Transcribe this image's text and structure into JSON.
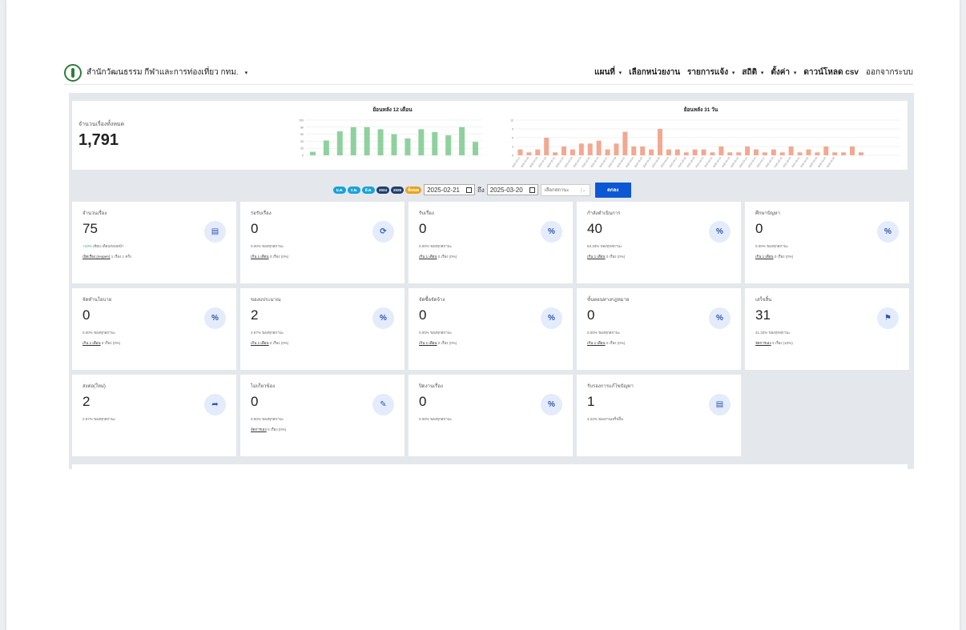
{
  "brand": {
    "name": "สำนักวัฒนธรรม กีฬาและการท่องเที่ยว กทม.",
    "caret": "▾"
  },
  "menu": [
    {
      "label": "แผนที่",
      "caret": "▾",
      "plain": false
    },
    {
      "label": "เลือกหน่วยงาน",
      "caret": "",
      "plain": false
    },
    {
      "label": "รายการแจ้ง",
      "caret": "▾",
      "plain": false
    },
    {
      "label": "สถิติ",
      "caret": "▾",
      "plain": false
    },
    {
      "label": "ตั้งค่า",
      "caret": "▾",
      "plain": false
    },
    {
      "label": "ดาวน์โหลด csv",
      "caret": "",
      "plain": false
    },
    {
      "label": "ออกจากระบบ",
      "caret": "",
      "plain": true
    }
  ],
  "summary": {
    "label": "จำนวนเรื่องทั้งหมด",
    "value": "1,791"
  },
  "chart_data": [
    {
      "type": "bar",
      "title": "ย้อนหลัง 12 เดือน",
      "ylim": [
        0,
        100
      ],
      "yticks": [
        "100",
        "80",
        "60",
        "40",
        "20",
        "0"
      ],
      "categories": [
        "1",
        "2",
        "3",
        "4",
        "5",
        "6",
        "7",
        "8",
        "9",
        "10",
        "11",
        "12"
      ],
      "values": [
        10,
        42,
        68,
        80,
        80,
        74,
        60,
        48,
        74,
        66,
        57,
        80,
        38
      ],
      "color": "#8fd19e"
    },
    {
      "type": "bar",
      "title": "ย้อนหลัง 31 วัน",
      "ylim": [
        0,
        12
      ],
      "yticks": [
        "12",
        "9",
        "6",
        "3",
        "0"
      ],
      "categories": [
        "2025-02-17",
        "2025-02-18",
        "2025-02-19",
        "2025-02-20",
        "2025-02-21",
        "2025-02-22",
        "2025-02-23",
        "2025-02-24",
        "2025-02-25",
        "2025-02-26",
        "2025-02-27",
        "2025-02-28",
        "2025-03-01",
        "2025-03-02",
        "2025-03-03",
        "2025-03-04",
        "2025-03-05",
        "2025-03-06",
        "2025-03-07",
        "2025-03-08",
        "2025-03-09",
        "2025-03-10",
        "2025-03-11",
        "2025-03-12",
        "2025-03-13",
        "2025-03-14",
        "2025-03-15",
        "2025-03-16",
        "2025-03-17",
        "2025-03-18",
        "2025-03-19",
        "2025-03-20",
        "2025-03-21",
        "2025-03-22",
        "2025-03-23",
        "2025-03-24",
        "2025-03-25"
      ],
      "values": [
        2,
        1,
        2,
        6,
        1,
        3,
        2,
        4,
        4,
        5,
        2,
        4,
        8,
        3,
        3,
        2,
        9,
        2,
        2,
        1,
        2,
        2,
        1,
        3,
        1,
        1,
        3,
        2,
        1,
        2,
        1,
        3,
        1,
        2,
        1,
        3,
        1,
        1,
        3,
        1,
        0,
        0,
        0,
        0
      ],
      "color": "#f2a891"
    }
  ],
  "filters": {
    "pills": [
      {
        "label": "ม.ค.",
        "color": "#17a2d8"
      },
      {
        "label": "ก.พ.",
        "color": "#17a2d8"
      },
      {
        "label": "มี.ค.",
        "color": "#17a2d8"
      },
      {
        "label": "2024",
        "color": "#1f3e6e"
      },
      {
        "label": "2025",
        "color": "#1f3e6e"
      },
      {
        "label": "ทั้งหมด",
        "color": "#e8a21a"
      }
    ],
    "date_from": "2025-02-21",
    "to_label": "ถึง",
    "date_to": "2025-03-20",
    "status_placeholder": "เลือกสถานะ",
    "ok_label": "ตกลง"
  },
  "cards": [
    {
      "title": "จำนวนเรื่อง",
      "value": "75",
      "line1_green": "+10%",
      "line1": "เทียบ เดือนก่อนหน้า",
      "line2_link": "เปิดเรื่อง (reopen)",
      "line2": "1 เรื่อง 1 ครั้ง",
      "icon": "document-icon",
      "glyph": "▤",
      "big": true
    },
    {
      "title": "รอรับเรื่อง",
      "value": "0",
      "line1_green": "",
      "line1": "0.00% ของทุกสถานะ",
      "line2_link": "เกิน 1 เดือน",
      "line2": "0 เรื่อง (0%)",
      "icon": "refresh-icon",
      "glyph": "⟳",
      "big": false
    },
    {
      "title": "รับเรื่อง",
      "value": "0",
      "line1_green": "",
      "line1": "0.00% ของทุกสถานะ",
      "line2_link": "เกิน 1 เดือน",
      "line2": "0 เรื่อง (0%)",
      "icon": "percent-icon",
      "glyph": "%",
      "big": false
    },
    {
      "title": "กำลังดำเนินการ",
      "value": "40",
      "line1_green": "",
      "line1": "53.33% ของทุกสถานะ",
      "line2_link": "เกิน 1 เดือน",
      "line2": "0 เรื่อง (0%)",
      "icon": "percent-icon",
      "glyph": "%",
      "big": true
    },
    {
      "title": "ศึกษาปัญหา",
      "value": "0",
      "line1_green": "",
      "line1": "0.00% ของทุกสถานะ",
      "line2_link": "เกิน 1 เดือน",
      "line2": "0 เรื่อง (0%)",
      "icon": "percent-icon",
      "glyph": "%",
      "big": false
    },
    {
      "title": "จัดทำนโยบาย",
      "value": "0",
      "line1_green": "",
      "line1": "0.00% ของทุกสถานะ",
      "line2_link": "เกิน 1 เดือน",
      "line2": "0 เรื่อง (0%)",
      "icon": "percent-icon",
      "glyph": "%",
      "big": false
    },
    {
      "title": "ของบประมาณ",
      "value": "2",
      "line1_green": "",
      "line1": "2.67% ของทุกสถานะ",
      "line2_link": "เกิน 1 เดือน",
      "line2": "0 เรื่อง (0%)",
      "icon": "percent-icon",
      "glyph": "%",
      "big": false
    },
    {
      "title": "จัดซื้อจัดจ้าง",
      "value": "0",
      "line1_green": "",
      "line1": "0.00% ของทุกสถานะ",
      "line2_link": "เกิน 1 เดือน",
      "line2": "0 เรื่อง (0%)",
      "icon": "percent-icon",
      "glyph": "%",
      "big": false
    },
    {
      "title": "ขั้นตอนทางกฎหมาย",
      "value": "0",
      "line1_green": "",
      "line1": "0.00% ของทุกสถานะ",
      "line2_link": "เกิน 1 เดือน",
      "line2": "0 เรื่อง (0%)",
      "icon": "percent-icon",
      "glyph": "%",
      "big": false
    },
    {
      "title": "เสร็จสิ้น",
      "value": "31",
      "line1_green": "",
      "line1": "41.33% ของทุกสถานะ",
      "line2_link": "จัดการเอง",
      "line2": "3 เรื่อง (10%)",
      "icon": "flag-icon",
      "glyph": "⚑",
      "big": true
    },
    {
      "title": "ส่งต่อ(ใหม่)",
      "value": "2",
      "line1_green": "",
      "line1": "2.67% ของทุกสถานะ",
      "line2_link": "",
      "line2": "",
      "icon": "share-icon",
      "glyph": "➦",
      "big": false
    },
    {
      "title": "ไม่เกี่ยวข้อง",
      "value": "0",
      "line1_green": "",
      "line1": "0.00% ของทุกสถานะ",
      "line2_link": "จัดการเอง",
      "line2": "0 เรื่อง (0%)",
      "icon": "edit-icon",
      "glyph": "✎",
      "big": false
    },
    {
      "title": "ปิดงานเรื่อง",
      "value": "0",
      "line1_green": "",
      "line1": "0.00% ของทุกสถานะ",
      "line2_link": "",
      "line2": "",
      "icon": "percent-icon",
      "glyph": "%",
      "big": false
    },
    {
      "title": "รับรองการแก้ไขปัญหา",
      "value": "1",
      "line1_green": "",
      "line1": "3.23% ของงานเสร็จสิ้น",
      "line2_link": "",
      "line2": "",
      "icon": "documents-icon",
      "glyph": "▤",
      "big": true
    }
  ]
}
